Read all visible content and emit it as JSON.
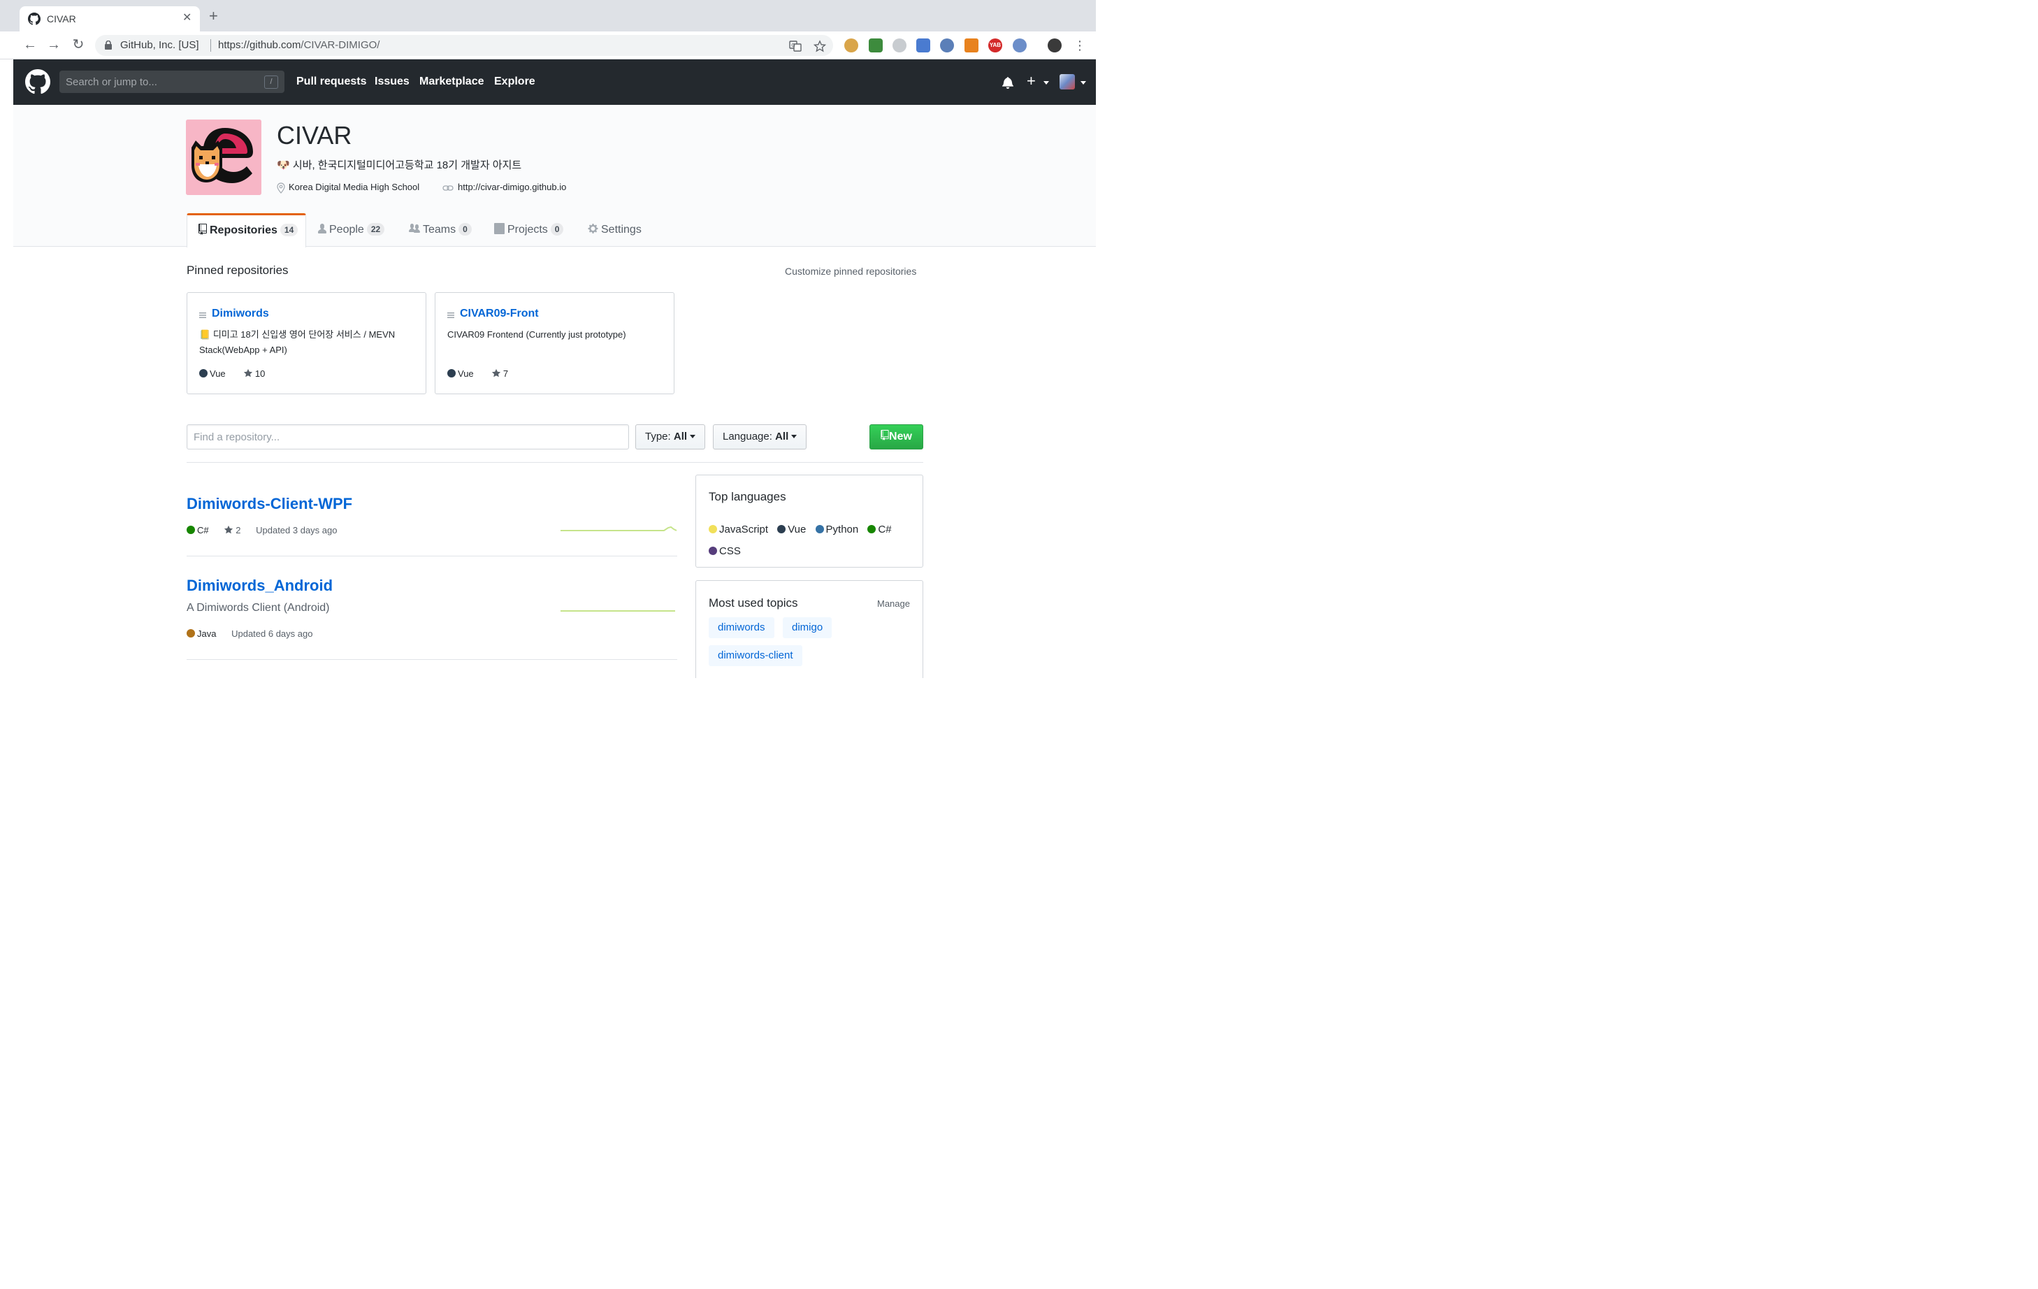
{
  "browser": {
    "tab_title": "CIVAR",
    "new_tab_label": "+",
    "org_identity": "GitHub, Inc. [US]",
    "url_host": "https://github.com",
    "url_path": "/CIVAR-DIMIGO/",
    "extension_yab_label": "YAB"
  },
  "gh_header": {
    "search_placeholder": "Search or jump to...",
    "search_shortcut": "/",
    "nav": [
      "Pull requests",
      "Issues",
      "Marketplace",
      "Explore"
    ],
    "new_label": "+"
  },
  "org": {
    "name": "CIVAR",
    "description_emoji": "🐶",
    "description": "시바, 한국디지털미디어고등학교 18기 개발자 아지트",
    "location": "Korea Digital Media High School",
    "website": "http://civar-dimigo.github.io"
  },
  "org_tabs": [
    {
      "label": "Repositories",
      "count": "14",
      "icon": "repo-icon"
    },
    {
      "label": "People",
      "count": "22",
      "icon": "person-icon"
    },
    {
      "label": "Teams",
      "count": "0",
      "icon": "team-icon"
    },
    {
      "label": "Projects",
      "count": "0",
      "icon": "project-icon"
    },
    {
      "label": "Settings",
      "count": "",
      "icon": "gear-icon"
    }
  ],
  "pinned": {
    "title": "Pinned repositories",
    "customize_label": "Customize pinned repositories",
    "items": [
      {
        "name": "Dimiwords",
        "desc_emoji": "📒",
        "description": "디미고 18기 신입생 영어 단어장 서비스 / MEVN Stack(WebApp + API)",
        "language": "Vue",
        "stars": "10"
      },
      {
        "name": "CIVAR09-Front",
        "description": "CIVAR09 Frontend (Currently just prototype)",
        "language": "Vue",
        "stars": "7"
      }
    ]
  },
  "filters": {
    "search_placeholder": "Find a repository...",
    "type_label": "Type:",
    "type_value": "All",
    "language_label": "Language:",
    "language_value": "All",
    "new_label": "New"
  },
  "repos": [
    {
      "name": "Dimiwords-Client-WPF",
      "description": "",
      "language": "C#",
      "stars": "2",
      "updated": "Updated 3 days ago"
    },
    {
      "name": "Dimiwords_Android",
      "description": "A Dimiwords Client (Android)",
      "language": "Java",
      "stars": "",
      "updated": "Updated 6 days ago"
    }
  ],
  "top_languages": {
    "title": "Top languages",
    "items": [
      "JavaScript",
      "Vue",
      "Python",
      "C#",
      "CSS"
    ]
  },
  "topics": {
    "title": "Most used topics",
    "manage_label": "Manage",
    "items": [
      "dimiwords",
      "dimigo",
      "dimiwords-client"
    ]
  },
  "colors": {
    "link_blue": "#0366d6",
    "header_dark": "#24292e",
    "tab_accent": "#e36209",
    "new_button_green": "#28a745",
    "vue": "#2c3e50",
    "csharp": "#178600",
    "java": "#b07219",
    "javascript": "#f1e05a",
    "python": "#3572A5",
    "css": "#563d7c",
    "sparkline": "#c6e48b"
  }
}
